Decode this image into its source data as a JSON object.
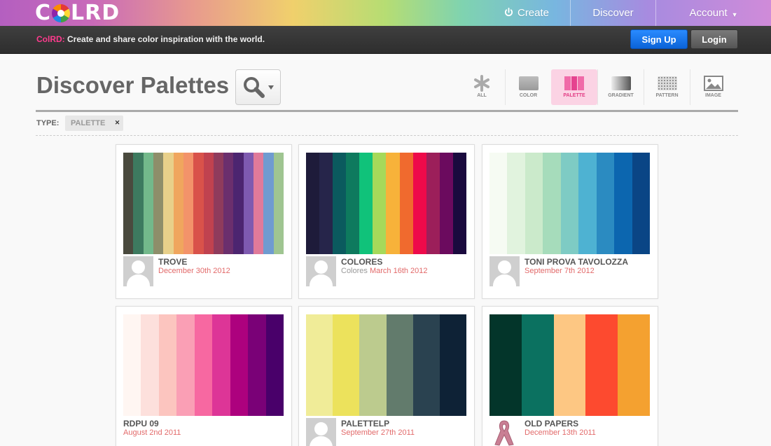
{
  "header": {
    "logo_text": "COLRD",
    "nav": {
      "create": "Create",
      "discover": "Discover",
      "account": "Account"
    }
  },
  "strip": {
    "brand": "ColRD:",
    "tagline": " Create and share color inspiration with the world.",
    "signup": "Sign Up",
    "login": "Login"
  },
  "page": {
    "title": "Discover Palettes",
    "type_label": "TYPE:",
    "type_chip": "PALETTE",
    "tabs": [
      {
        "label": "ALL",
        "icon": "asterisk-icon"
      },
      {
        "label": "COLOR",
        "icon": "color-swatch-icon"
      },
      {
        "label": "PALETTE",
        "icon": "palette-icon",
        "active": true
      },
      {
        "label": "GRADIENT",
        "icon": "gradient-icon"
      },
      {
        "label": "PATTERN",
        "icon": "pattern-icon"
      },
      {
        "label": "IMAGE",
        "icon": "image-icon"
      }
    ]
  },
  "cards": [
    {
      "title": "TROVE",
      "date": "December 30th 2012",
      "date_prefix": "",
      "avatar": "default",
      "colors": [
        "#4a4a3e",
        "#3d7a5f",
        "#73b98b",
        "#8e8e6a",
        "#e8d08a",
        "#f0a65e",
        "#f3936a",
        "#d9524a",
        "#c0424f",
        "#8f3b5c",
        "#6b2f6d",
        "#4c2570",
        "#7e5ab0",
        "#e07a9a",
        "#6f9bd0",
        "#9fc591"
      ]
    },
    {
      "title": "COLORES",
      "date": "March 16th 2012",
      "date_prefix": "Colores ",
      "avatar": "default",
      "colors": [
        "#1e1b3a",
        "#26254a",
        "#0b5a5e",
        "#0e7a5e",
        "#10c27a",
        "#a6d95a",
        "#f7b23a",
        "#f06a2e",
        "#ee0a4a",
        "#9c1f5a",
        "#6b0a5e",
        "#1a0a3e"
      ]
    },
    {
      "title": "TONI PROVA TAVOLOZZA",
      "date": "September 7th 2012",
      "date_prefix": "",
      "avatar": "default",
      "colors": [
        "#f6fbf3",
        "#e1f3de",
        "#cbeacb",
        "#a6dcbb",
        "#7ecbc4",
        "#4eb2d2",
        "#2b8bc1",
        "#0c66af",
        "#0a4585"
      ]
    },
    {
      "title": "RDPU 09",
      "date": "August 2nd 2011",
      "date_prefix": "",
      "avatar": "none",
      "colors": [
        "#fff6f2",
        "#fde0dc",
        "#fcc5bf",
        "#fa9fb5",
        "#f768a1",
        "#dd3597",
        "#ad017e",
        "#7a0177",
        "#49006a"
      ]
    },
    {
      "title": "PALETTELP",
      "date": "September 27th 2011",
      "date_prefix": "",
      "avatar": "default",
      "colors": [
        "#f0ec98",
        "#ece25c",
        "#bccb8e",
        "#627b6c",
        "#2a4250",
        "#0e2236"
      ]
    },
    {
      "title": "OLD PAPERS",
      "date": "December 13th 2011",
      "date_prefix": "",
      "avatar": "ribbon",
      "colors": [
        "#03352a",
        "#0b7160",
        "#fdc783",
        "#fd4a2f",
        "#f4a130"
      ]
    }
  ]
}
